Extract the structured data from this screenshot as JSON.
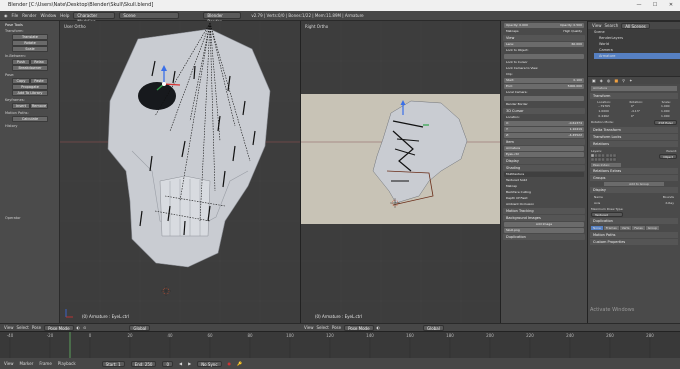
{
  "window": {
    "title": "Blender [C:\\Users\\Nate\\Desktop\\Blender\\Skull\\Skull.blend]",
    "minimize": "—",
    "maximize": "☐",
    "close": "✕"
  },
  "header": {
    "menus": [
      "File",
      "Render",
      "Window",
      "Help"
    ],
    "workspace": "Character Modeling",
    "scene": "Scene",
    "engine": "Blender Render",
    "stats": "v2.79 | Verts:0/0 | Bones:1/22 | Mem:11.89M | Armature"
  },
  "tools": {
    "panel_title": "Pose Tools",
    "transform_label": "Transform:",
    "translate": "Translate",
    "rotate": "Rotate",
    "scale": "Scale",
    "in_between_label": "In-Between:",
    "push": "Push",
    "relax": "Relax",
    "breakdowner": "Breakdowner",
    "pose_label": "Pose:",
    "copy": "Copy",
    "paste": "Paste",
    "propagate": "Propagate",
    "library": "Add To Library",
    "keyframes_label": "Keyframes:",
    "insert": "Insert",
    "remove": "Remove",
    "motion_label": "Motion Paths:",
    "calculate": "Calculate",
    "history": "History",
    "operator": "Operator"
  },
  "viewport_left": {
    "label": "User Ortho",
    "status": "(0) Armature : EyeL.ctrl"
  },
  "viewport_right": {
    "label": "Right Ortho",
    "status": "(0) Armature : EyeL.ctrl"
  },
  "view_bar": {
    "view": "View",
    "select": "Select",
    "pose": "Pose",
    "mode": "Pose Mode",
    "pivot": "Global"
  },
  "properties": {
    "opacity_label": "Opacity: 0.000",
    "opacity2": "Opacity: 0.500",
    "matcap": "Matcaps",
    "high_quality": "High Quality",
    "view": "View",
    "lens_label": "Lens:",
    "lens_val": "60.000",
    "lock_object": "Lock to Object:",
    "lock_cursor": "Lock to Cursor",
    "lock_camera": "Lock Camera to View",
    "clip": "Clip:",
    "start_label": "Start:",
    "start_val": "0.100",
    "end_label": "End:",
    "end_val": "5000.000",
    "local_camera": "Local Camera:",
    "render_border": "Render Border",
    "cursor": "3D Cursor",
    "location": "Location:",
    "x_label": "X:",
    "x_val": "-0.61374",
    "y_label": "Y:",
    "y_val": "1.10419",
    "z_label": "Z:",
    "z_val": "-4.45522",
    "item": "Item",
    "armature": "Armature",
    "bone": "EyeL.ctrl",
    "display": "Display",
    "shading": "Shading",
    "multitexture": "Multitexture",
    "textured_solid": "Textured Solid",
    "matcap2": "Matcap",
    "backface": "Backface Culling",
    "depth": "Depth Of Field",
    "ambient": "Ambient Occlusion",
    "motion_tracking": "Motion Tracking",
    "bg_images": "Background Images",
    "add_image": "Add Image",
    "image_file": "Skull.png",
    "duplication": "Duplication"
  },
  "outliner": {
    "view": "View",
    "search": "Search",
    "all_scenes": "All Scenes",
    "items": [
      "Scene",
      "RenderLayers",
      "World",
      "Camera",
      "Armature"
    ]
  },
  "props2": {
    "armature_name": "Armature",
    "transform": "Transform",
    "location": "Location:",
    "rotation": "Rotation:",
    "scale": "Scale:",
    "loc": [
      "-.79765",
      "1.0000",
      "0.4462"
    ],
    "rot": [
      "0°",
      "-4.13°",
      "0°"
    ],
    "scl": [
      "1.000",
      "1.000",
      "1.000"
    ],
    "rotation_mode": "Rotation Mode:",
    "xyz_euler": "XYZ Euler",
    "delta": "Delta Transform",
    "transform_locks": "Transform Locks",
    "relations": "Relations",
    "layers": "Layers:",
    "parent": "Parent:",
    "parent_type": "Object",
    "pass_index": "Pass Index:",
    "rel_extras": "Relations Extras",
    "groups": "Groups",
    "add_group": "Add to Group",
    "display": "Display",
    "name": "Name",
    "axis": "Axis",
    "bounds": "Bounds",
    "xray": "X-Ray",
    "max_draw": "Maximum Draw Type:",
    "textured": "Textured",
    "duplication": "Duplication",
    "dup_tabs": [
      "None",
      "Frames",
      "Verts",
      "Faces",
      "Group"
    ],
    "motion_paths": "Motion Paths",
    "custom_props": "Custom Properties",
    "watermark": "Activate Windows"
  },
  "timeline": {
    "ticks": [
      "-40",
      "-20",
      "0",
      "20",
      "40",
      "60",
      "80",
      "100",
      "120",
      "140",
      "160",
      "180",
      "200",
      "220",
      "240",
      "260",
      "280"
    ],
    "view": "View",
    "marker": "Marker",
    "frame": "Frame",
    "playback": "Playback",
    "start_label": "Start:",
    "start_val": "1",
    "end_label": "End:",
    "end_val": "250",
    "current": "0",
    "sync": "No Sync"
  },
  "colors": {
    "accent": "#5680c2",
    "bone_line": "#111111",
    "skull": "#c9ccd2",
    "bg_image": "#c8c3b6"
  }
}
